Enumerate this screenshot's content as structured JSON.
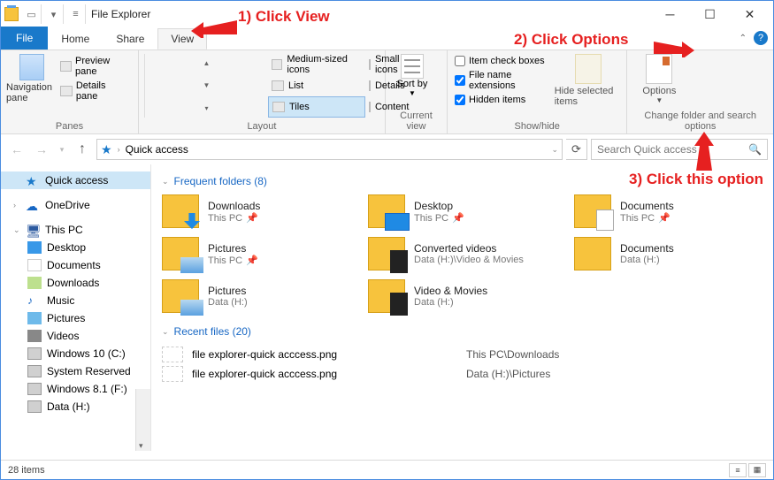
{
  "window": {
    "title": "File Explorer"
  },
  "tabs": {
    "file": "File",
    "home": "Home",
    "share": "Share",
    "view": "View"
  },
  "ribbon": {
    "panes": {
      "nav": "Navigation pane",
      "preview": "Preview pane",
      "details": "Details pane",
      "label": "Panes"
    },
    "layout": {
      "label": "Layout",
      "medium": "Medium-sized icons",
      "small": "Small icons",
      "list": "List",
      "details": "Details",
      "tiles": "Tiles",
      "content": "Content"
    },
    "current": {
      "sort": "Sort by",
      "label": "Current view"
    },
    "show": {
      "checkboxes": "Item check boxes",
      "ext": "File name extensions",
      "hidden": "Hidden items",
      "hide_btn": "Hide selected items",
      "label": "Show/hide",
      "checked_ext": true,
      "checked_hidden": true,
      "checked_boxes": false
    },
    "options": {
      "label": "Options",
      "opt": "Change folder and search options"
    }
  },
  "address": {
    "location": "Quick access",
    "search_placeholder": "Search Quick access"
  },
  "tree": {
    "quick": "Quick access",
    "onedrive": "OneDrive",
    "thispc": "This PC",
    "desktop": "Desktop",
    "documents": "Documents",
    "downloads": "Downloads",
    "music": "Music",
    "pictures": "Pictures",
    "videos": "Videos",
    "drive_c": "Windows 10 (C:)",
    "drive_sys": "System Reserved",
    "drive_f": "Windows 8.1 (F:)",
    "drive_h": "Data (H:)"
  },
  "content": {
    "freq_h": "Frequent folders (8)",
    "recent_h": "Recent files (20)",
    "folders": [
      {
        "name": "Downloads",
        "loc": "This PC",
        "ic": "down",
        "pin": true
      },
      {
        "name": "Desktop",
        "loc": "This PC",
        "ic": "desk",
        "pin": true
      },
      {
        "name": "Documents",
        "loc": "This PC",
        "ic": "doc",
        "pin": true
      },
      {
        "name": "Pictures",
        "loc": "This PC",
        "ic": "pic",
        "pin": true
      },
      {
        "name": "Converted videos",
        "loc": "Data (H:)\\Video & Movies",
        "ic": "vid"
      },
      {
        "name": "Documents",
        "loc": "Data (H:)",
        "ic": "plain"
      },
      {
        "name": "Pictures",
        "loc": "Data (H:)",
        "ic": "pic"
      },
      {
        "name": "Video & Movies",
        "loc": "Data (H:)",
        "ic": "vid"
      }
    ],
    "files": [
      {
        "name": "file explorer-quick acccess.png",
        "loc": "This PC\\Downloads"
      },
      {
        "name": "file explorer-quick acccess.png",
        "loc": "Data (H:)\\Pictures"
      }
    ]
  },
  "status": {
    "count": "28 items"
  },
  "annotations": {
    "a1": "1) Click View",
    "a2": "2) Click Options",
    "a3": "3) Click this option"
  }
}
